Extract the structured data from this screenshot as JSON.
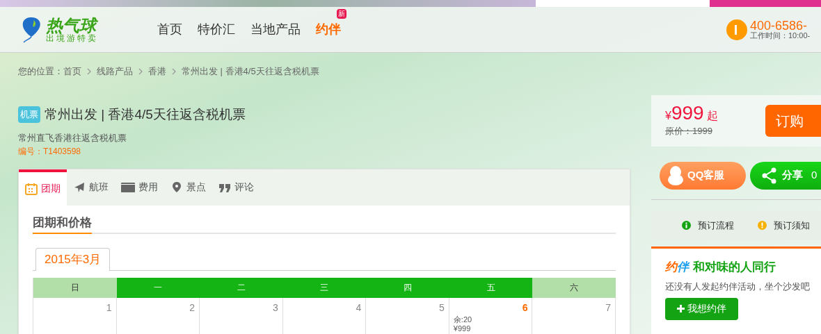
{
  "header": {
    "logo": {
      "name": "热气球",
      "slogan": "出境游特卖"
    },
    "nav": [
      {
        "label": "首页",
        "highlight": false
      },
      {
        "label": "特价汇",
        "highlight": false
      },
      {
        "label": "当地产品",
        "highlight": false
      },
      {
        "label": "约伴",
        "highlight": true,
        "badge": "新"
      }
    ],
    "phone": "400-6586-",
    "hours": "工作时间：10:00-"
  },
  "breadcrumb": [
    "您的位置：首页",
    "线路产品",
    "香港",
    "常州出发 | 香港4/5天往返含税机票"
  ],
  "product": {
    "tag": "机票",
    "title": "常州出发 | 香港4/5天往返含税机票",
    "subtitle": "常州直飞香港往返含税机票",
    "code": "编号：T1403598"
  },
  "price": {
    "currency": "¥",
    "amount": "999",
    "suffix": "起",
    "original": "原价：1999",
    "order_button": "订购"
  },
  "tabs": [
    {
      "label": "团期",
      "selected": true
    },
    {
      "label": "航班",
      "selected": false
    },
    {
      "label": "费用",
      "selected": false
    },
    {
      "label": "景点",
      "selected": false
    },
    {
      "label": "评论",
      "selected": false
    }
  ],
  "section_title": "团期和价格",
  "month_tab": "2015年3月",
  "calendar": {
    "weekdays": [
      {
        "label": "日",
        "weekend": true
      },
      {
        "label": "一",
        "weekend": false
      },
      {
        "label": "二",
        "weekend": false
      },
      {
        "label": "三",
        "weekend": false
      },
      {
        "label": "四",
        "weekend": false
      },
      {
        "label": "五",
        "weekend": false
      },
      {
        "label": "六",
        "weekend": true
      }
    ],
    "days": [
      {
        "day": "1",
        "available": false
      },
      {
        "day": "2",
        "available": false
      },
      {
        "day": "3",
        "available": false
      },
      {
        "day": "4",
        "available": false
      },
      {
        "day": "5",
        "available": false
      },
      {
        "day": "6",
        "available": true,
        "remaining": "余:20",
        "price": "¥999"
      },
      {
        "day": "7",
        "available": false
      }
    ]
  },
  "side": {
    "qq_button": "QQ客服",
    "share_button": "分享",
    "share_count": "0",
    "links": [
      {
        "label": "预订流程",
        "kind": "info"
      },
      {
        "label": "预订须知",
        "kind": "warning"
      }
    ],
    "yueban": {
      "brand_a": "约",
      "brand_b": "伴",
      "title": "和对味的人同行",
      "text": "还没有人发起约伴活动，坐个沙发吧",
      "button": "我想约伴"
    }
  }
}
